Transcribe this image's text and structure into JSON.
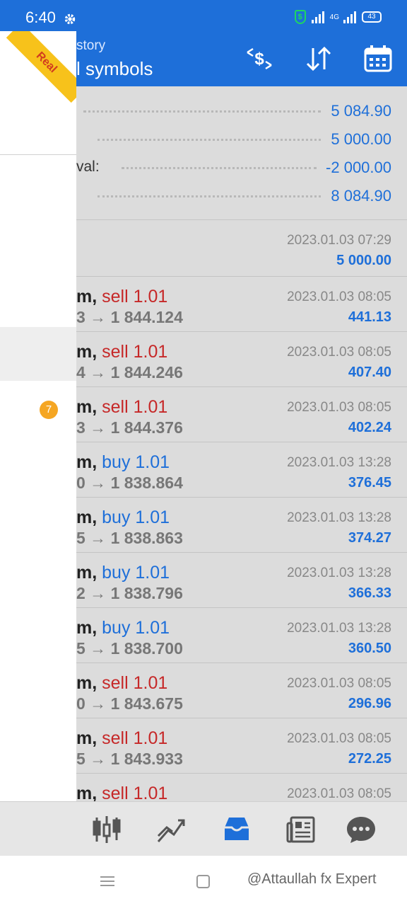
{
  "status_bar": {
    "time": "6:40",
    "network": "4G",
    "battery": "43"
  },
  "app_bar": {
    "subtitle": "story",
    "title": "l symbols",
    "icons": [
      "deposit-withdraw-icon",
      "sort-icon",
      "calendar-icon"
    ]
  },
  "drawer": {
    "ribbon_label": "Real",
    "badge_count": "7"
  },
  "summary": [
    {
      "label": "",
      "value": "5 084.90"
    },
    {
      "label": "",
      "value": "5 000.00"
    },
    {
      "label": "val:",
      "value": "-2 000.00"
    },
    {
      "label": "",
      "value": "8 084.90"
    }
  ],
  "balance_entry": {
    "time": "2023.01.03 07:29",
    "amount": "5 000.00"
  },
  "deals": [
    {
      "symbol": "m,",
      "side": "sell",
      "volume": "1.01",
      "price_line": "3 → 1 844.124",
      "time": "2023.01.03 08:05",
      "profit": "441.13"
    },
    {
      "symbol": "m,",
      "side": "sell",
      "volume": "1.01",
      "price_line": "4 → 1 844.246",
      "time": "2023.01.03 08:05",
      "profit": "407.40"
    },
    {
      "symbol": "m,",
      "side": "sell",
      "volume": "1.01",
      "price_line": "3 → 1 844.376",
      "time": "2023.01.03 08:05",
      "profit": "402.24"
    },
    {
      "symbol": "m,",
      "side": "buy",
      "volume": "1.01",
      "price_line": "0 → 1 838.864",
      "time": "2023.01.03 13:28",
      "profit": "376.45"
    },
    {
      "symbol": "m,",
      "side": "buy",
      "volume": "1.01",
      "price_line": "5 → 1 838.863",
      "time": "2023.01.03 13:28",
      "profit": "374.27"
    },
    {
      "symbol": "m,",
      "side": "buy",
      "volume": "1.01",
      "price_line": "2 → 1 838.796",
      "time": "2023.01.03 13:28",
      "profit": "366.33"
    },
    {
      "symbol": "m,",
      "side": "buy",
      "volume": "1.01",
      "price_line": "5 → 1 838.700",
      "time": "2023.01.03 13:28",
      "profit": "360.50"
    },
    {
      "symbol": "m,",
      "side": "sell",
      "volume": "1.01",
      "price_line": "0 → 1 843.675",
      "time": "2023.01.03 08:05",
      "profit": "296.96"
    },
    {
      "symbol": "m,",
      "side": "sell",
      "volume": "1.01",
      "price_line": "5 → 1 843.933",
      "time": "2023.01.03 08:05",
      "profit": "272.25"
    },
    {
      "symbol": "m,",
      "side": "sell",
      "volume": "1.01",
      "price_line": "",
      "time": "2023.01.03 08:05",
      "profit": ""
    }
  ],
  "tabs": [
    "quotes-icon",
    "chart-icon",
    "history-icon",
    "news-icon",
    "chat-icon"
  ],
  "watermark": "@Attaullah fx Expert",
  "colors": {
    "accent": "#1E6FD9",
    "sell": "#C62828",
    "buy": "#1E6FD9",
    "badge": "#F5A623",
    "ribbon": "#F7C21B"
  }
}
